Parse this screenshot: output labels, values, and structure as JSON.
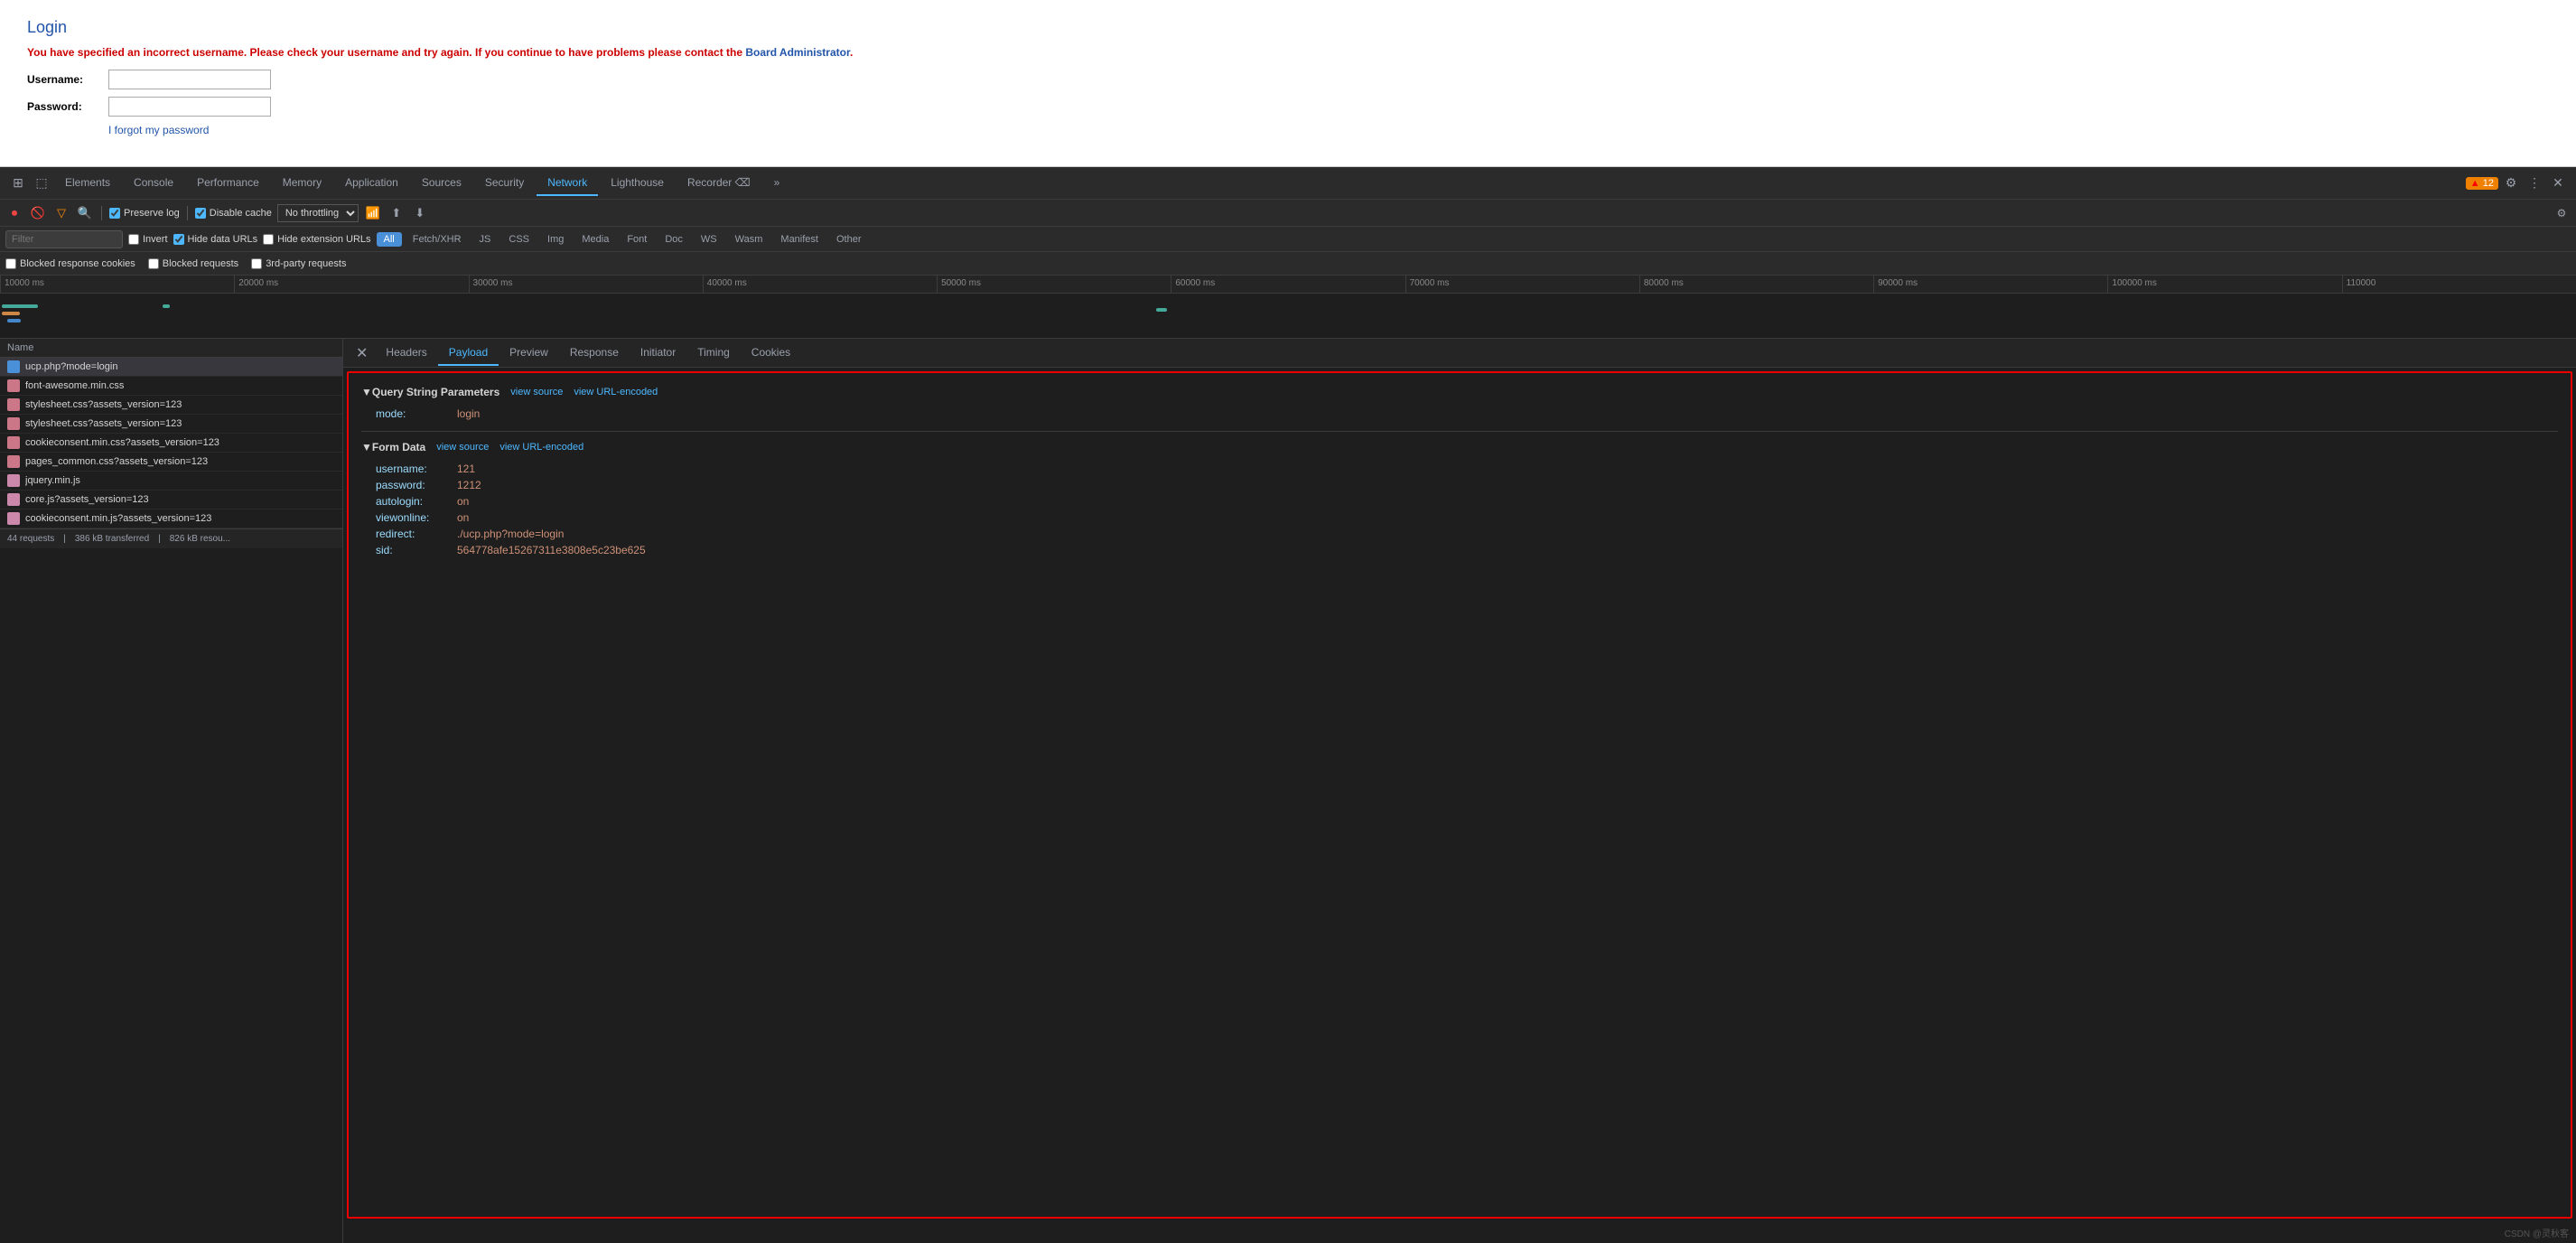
{
  "page": {
    "title": "Login",
    "error_message": "You have specified an incorrect username. Please check your username and try again. If you continue to have problems please contact the ",
    "error_link": "Board Administrator",
    "error_end": ".",
    "username_label": "Username:",
    "password_label": "Password:",
    "forgot_link": "I forgot my password"
  },
  "devtools": {
    "tabs": [
      {
        "label": "Elements",
        "active": false
      },
      {
        "label": "Console",
        "active": false
      },
      {
        "label": "Performance",
        "active": false
      },
      {
        "label": "Memory",
        "active": false
      },
      {
        "label": "Application",
        "active": false
      },
      {
        "label": "Sources",
        "active": false
      },
      {
        "label": "Security",
        "active": false
      },
      {
        "label": "Network",
        "active": true
      },
      {
        "label": "Lighthouse",
        "active": false
      },
      {
        "label": "Recorder ⌫",
        "active": false
      },
      {
        "label": "»",
        "active": false
      }
    ],
    "badge_count": "12",
    "toolbar": {
      "preserve_log": "Preserve log",
      "disable_cache": "Disable cache",
      "throttle": "No throttling"
    },
    "filter": {
      "placeholder": "Filter",
      "invert": "Invert",
      "hide_data": "Hide data URLs",
      "hide_ext": "Hide extension URLs",
      "tags": [
        "All",
        "Fetch/XHR",
        "JS",
        "CSS",
        "Img",
        "Media",
        "Font",
        "Doc",
        "WS",
        "Wasm",
        "Manifest",
        "Other"
      ]
    },
    "blocked_bar": {
      "blocked_response": "Blocked response cookies",
      "blocked_requests": "Blocked requests",
      "third_party": "3rd-party requests"
    },
    "timeline": {
      "marks": [
        "10000 ms",
        "20000 ms",
        "30000 ms",
        "40000 ms",
        "50000 ms",
        "60000 ms",
        "70000 ms",
        "80000 ms",
        "90000 ms",
        "100000 ms",
        "110000"
      ]
    }
  },
  "file_list": {
    "header": "Name",
    "items": [
      {
        "name": "ucp.php?mode=login",
        "type": "doc",
        "selected": true
      },
      {
        "name": "font-awesome.min.css",
        "type": "css"
      },
      {
        "name": "stylesheet.css?assets_version=123",
        "type": "css"
      },
      {
        "name": "stylesheet.css?assets_version=123",
        "type": "css"
      },
      {
        "name": "cookieconsent.min.css?assets_version=123",
        "type": "css"
      },
      {
        "name": "pages_common.css?assets_version=123",
        "type": "css"
      },
      {
        "name": "jquery.min.js",
        "type": "js"
      },
      {
        "name": "core.js?assets_version=123",
        "type": "js"
      },
      {
        "name": "cookieconsent.min.js?assets_version=123",
        "type": "js"
      }
    ],
    "status": {
      "requests": "44 requests",
      "transferred": "386 kB transferred",
      "resources": "826 kB resou..."
    }
  },
  "right_panel": {
    "tabs": [
      "Headers",
      "Payload",
      "Preview",
      "Response",
      "Initiator",
      "Timing",
      "Cookies"
    ],
    "active_tab": "Payload",
    "payload": {
      "query_string": {
        "title": "▼Query String Parameters",
        "view_source": "view source",
        "view_url_encoded": "view URL-encoded",
        "params": [
          {
            "key": "mode:",
            "val": "login"
          }
        ]
      },
      "form_data": {
        "title": "▼Form Data",
        "view_source": "view source",
        "view_url_encoded": "view URL-encoded",
        "params": [
          {
            "key": "username:",
            "val": "121"
          },
          {
            "key": "password:",
            "val": "1212"
          },
          {
            "key": "autologin:",
            "val": "on"
          },
          {
            "key": "viewonline:",
            "val": "on"
          },
          {
            "key": "redirect:",
            "val": "./ucp.php?mode=login"
          },
          {
            "key": "sid:",
            "val": "564778afe15267311e3808e5c23be625"
          }
        ]
      }
    }
  },
  "watermark": "CSDN @灵秋客"
}
